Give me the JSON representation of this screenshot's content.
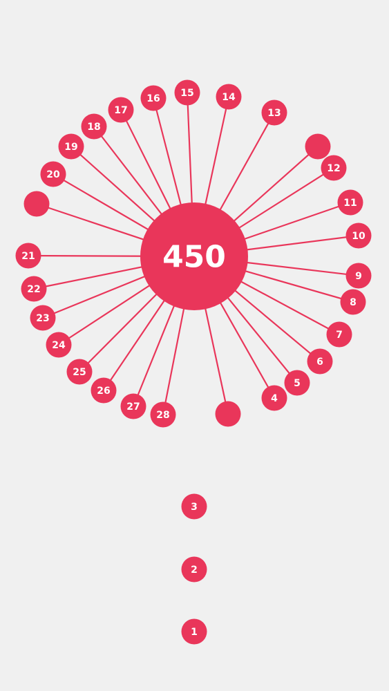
{
  "theme": {
    "background": "#f0f0f0",
    "accent": "#e9365a",
    "line": "#e9365a",
    "text": "#ffffff"
  },
  "level": {
    "number": "450"
  },
  "attached_pins": [
    {
      "label": "4"
    },
    {
      "label": "5"
    },
    {
      "label": "6"
    },
    {
      "label": "7"
    },
    {
      "label": "8"
    },
    {
      "label": "9"
    },
    {
      "label": "10"
    },
    {
      "label": "11"
    },
    {
      "label": "12"
    },
    {
      "label": "13"
    },
    {
      "label": "14"
    },
    {
      "label": "15"
    },
    {
      "label": "16"
    },
    {
      "label": "17"
    },
    {
      "label": "18"
    },
    {
      "label": "19"
    },
    {
      "label": "20"
    },
    {
      "label": "21"
    },
    {
      "label": "22"
    },
    {
      "label": "23"
    },
    {
      "label": "24"
    },
    {
      "label": "25"
    },
    {
      "label": "26"
    },
    {
      "label": "27"
    },
    {
      "label": "28"
    },
    {
      "label": ""
    },
    {
      "label": ""
    },
    {
      "label": ""
    }
  ],
  "queue_pins": [
    {
      "label": "3"
    },
    {
      "label": "2"
    },
    {
      "label": "1"
    }
  ]
}
